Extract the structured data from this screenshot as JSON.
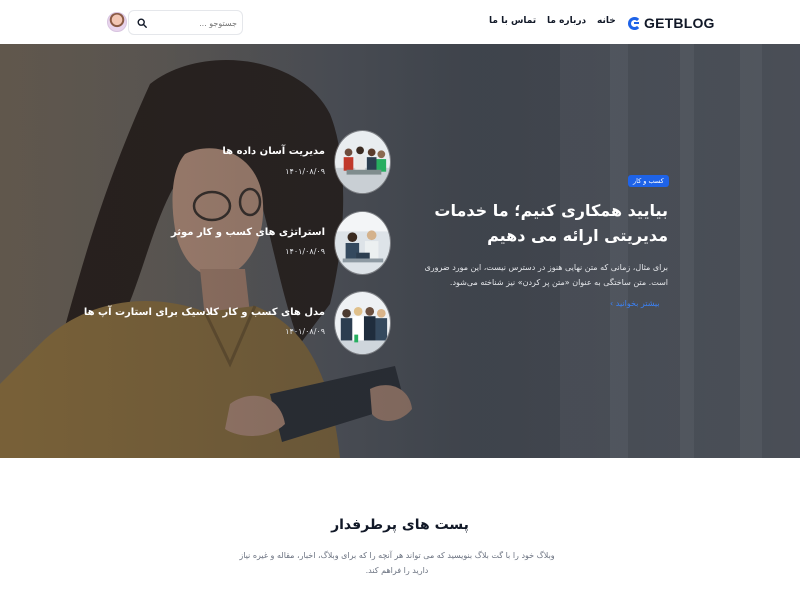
{
  "header": {
    "logo_text": "GETBLOG",
    "nav": {
      "home": "خانه",
      "about": "درباره ما",
      "contact": "تماس با ما"
    },
    "search": {
      "placeholder": "جستوجو ..."
    }
  },
  "hero": {
    "category": "کسب و کار",
    "title": "بیایید همکاری کنیم؛ ما خدمات مدیریتی ارائه می دهیم",
    "excerpt": "برای مثال، زمانی که متن نهایی هنوز در دسترس نیست، این مورد ضروری است. متن ساختگی به عنوان «متن پر کردن» نیز شناخته می‌شود.",
    "read_more": "بیشتر بخوانید",
    "read_more_arrow": "›",
    "side_posts": [
      {
        "title": "مدیریت آسان داده ها",
        "date": "۱۴۰۱/۰۸/۰۹"
      },
      {
        "title": "استراتژی های کسب و کار موثر",
        "date": "۱۴۰۱/۰۸/۰۹"
      },
      {
        "title": "مدل های کسب و کار کلاسیک برای استارت آپ ها",
        "date": "۱۴۰۱/۰۸/۰۹"
      }
    ]
  },
  "popular": {
    "title": "پست های پرطرفدار",
    "description": "وبلاگ خود را با گت بلاگ بنویسید که می تواند هر آنچه را که برای وبلاگ، اخبار، مقاله و غیره نیاز دارید را فراهم کند."
  },
  "colors": {
    "accent": "#1e63e8",
    "link": "#3b82f6"
  },
  "icons": [
    "logo-icon",
    "search-icon",
    "arrow-left-icon"
  ]
}
